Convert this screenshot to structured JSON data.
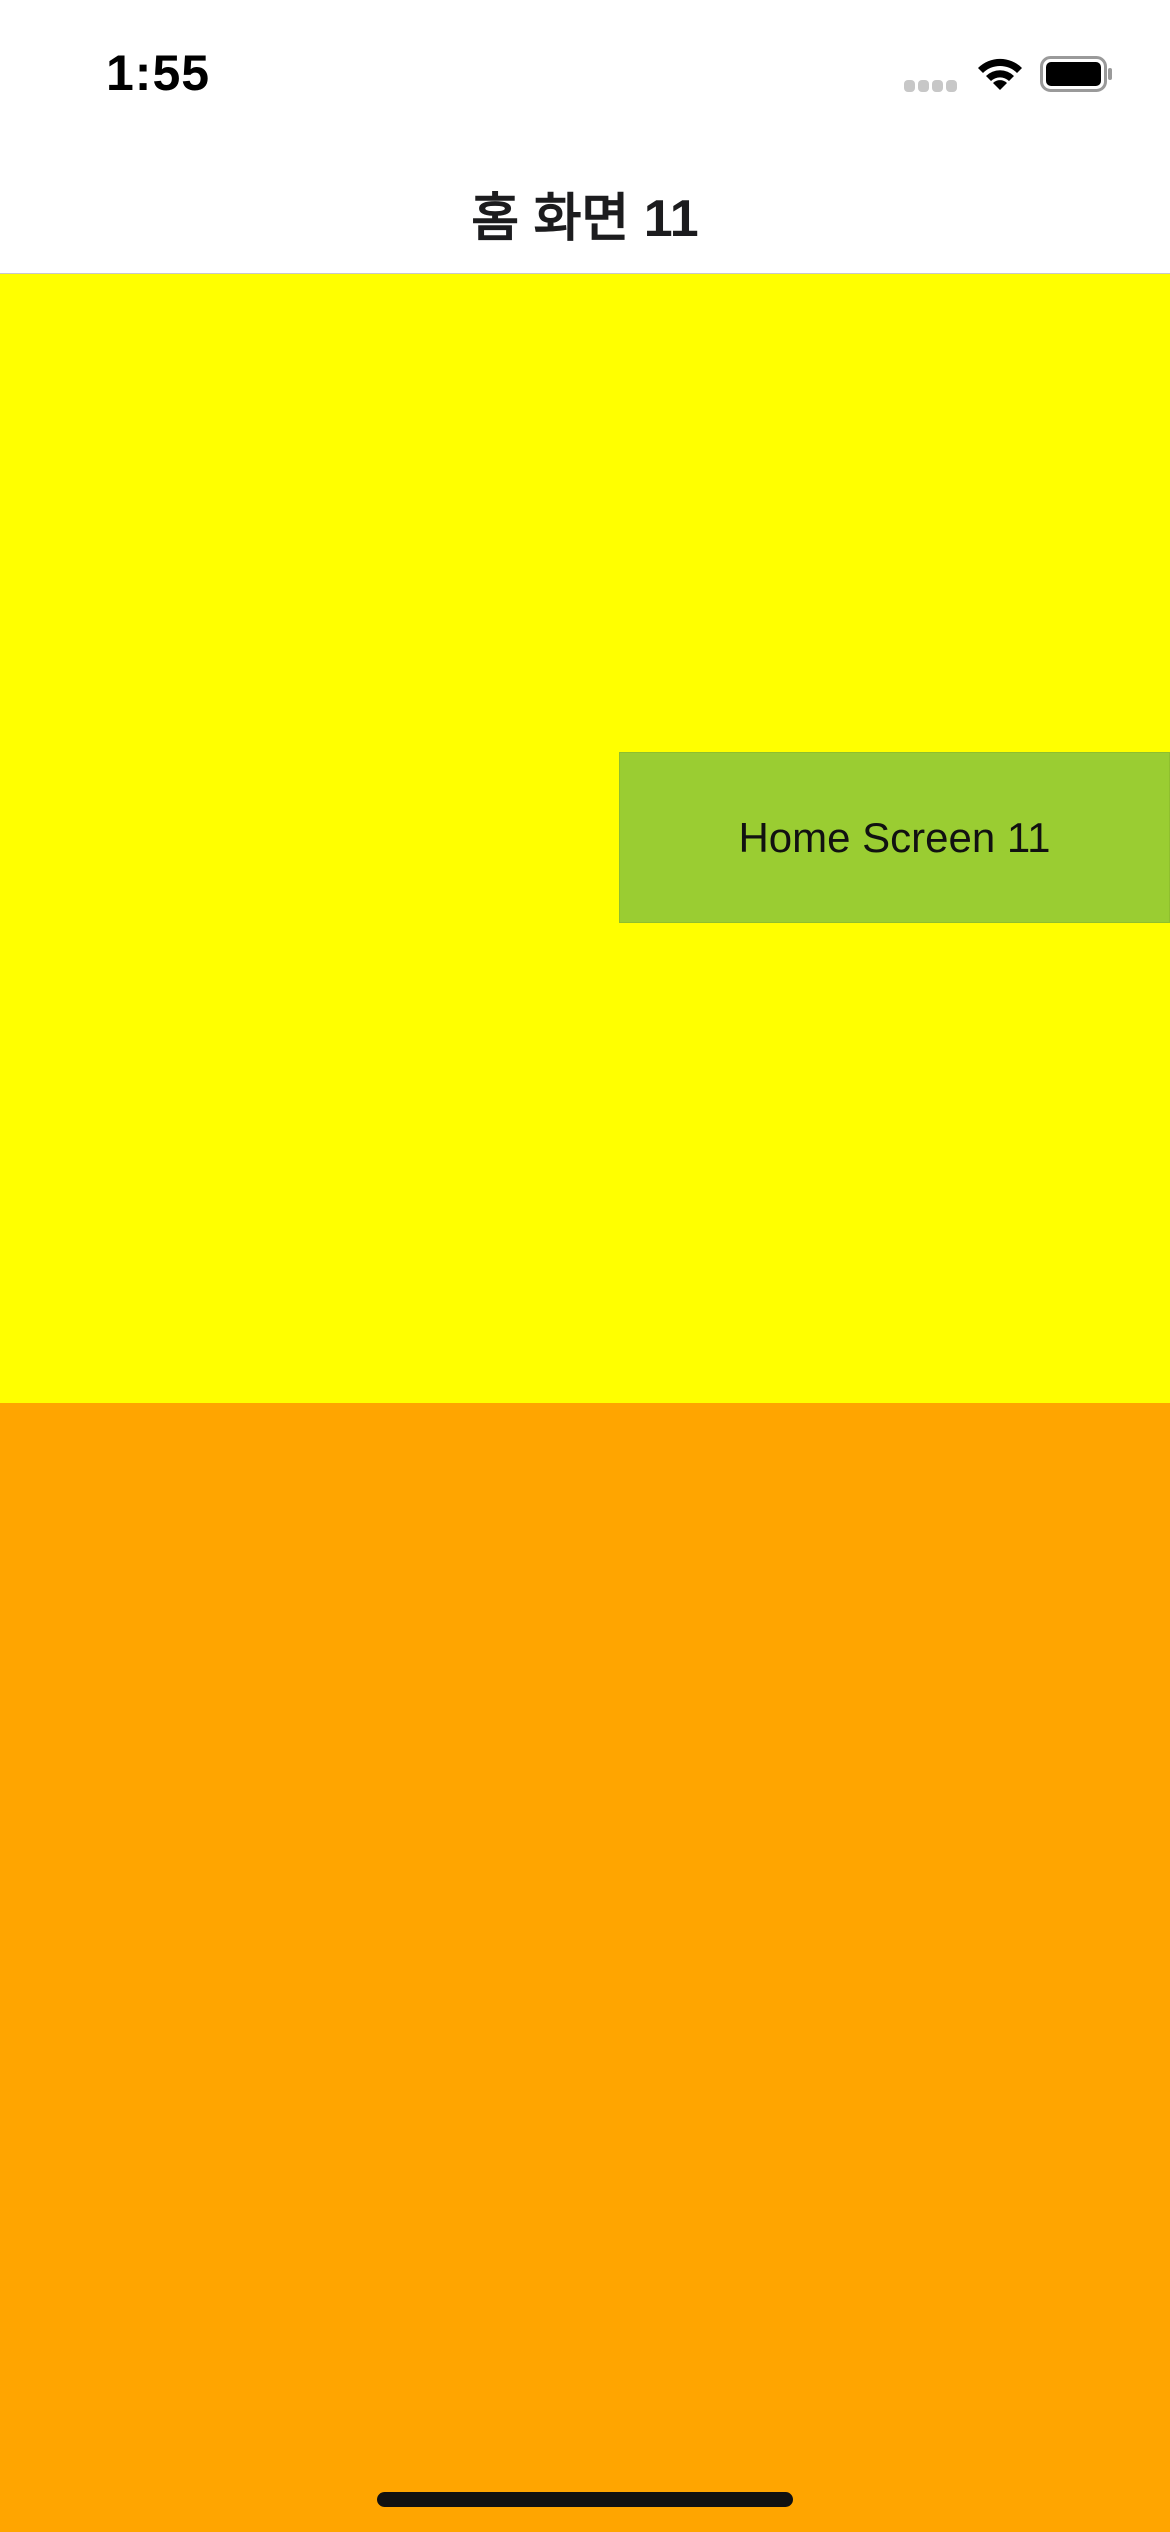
{
  "status_bar": {
    "time": "1:55",
    "icons": [
      "cellular-signal-icon",
      "wifi-icon",
      "battery-icon"
    ]
  },
  "nav_bar": {
    "title": "홈 화면 11"
  },
  "content": {
    "label_box_text": "Home Screen 11"
  },
  "colors": {
    "top_area": "#ffff00",
    "bottom_area": "#ffa500",
    "label_box": "#9acd32",
    "nav_background": "#ffffff"
  }
}
